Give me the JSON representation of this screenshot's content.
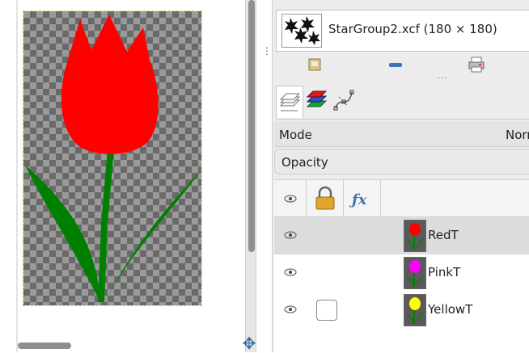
{
  "image": {
    "title": "StarGroup2.xcf (180 × 180)"
  },
  "toolbar": {
    "items": [
      {
        "icon": "open-folder-icon",
        "label": ""
      },
      {
        "icon": "minus-icon",
        "label": ""
      },
      {
        "icon": "printer-icon",
        "label": ""
      }
    ],
    "more_label": "···"
  },
  "dock_tabs": [
    {
      "icon": "layers-tab-icon",
      "active": true
    },
    {
      "icon": "channels-tab-icon",
      "active": false
    },
    {
      "icon": "paths-tab-icon",
      "active": false
    }
  ],
  "layers_panel": {
    "mode_label": "Mode",
    "mode_value": "Norm",
    "opacity_label": "Opacity",
    "header_icons": [
      "eye-header-icon",
      "lock-icon",
      "fx-icon"
    ],
    "layers": [
      {
        "name": "RedT",
        "flower_color": "#ff0000",
        "selected": true,
        "chain_visible": false
      },
      {
        "name": "PinkT",
        "flower_color": "#ff00ff",
        "selected": false,
        "chain_visible": false
      },
      {
        "name": "YellowT",
        "flower_color": "#ffff00",
        "selected": false,
        "chain_visible": true
      }
    ]
  },
  "canvas": {
    "tulip_color": "#ff0000",
    "stem_color": "#008000",
    "navigate_icon": "navigate-icon"
  }
}
